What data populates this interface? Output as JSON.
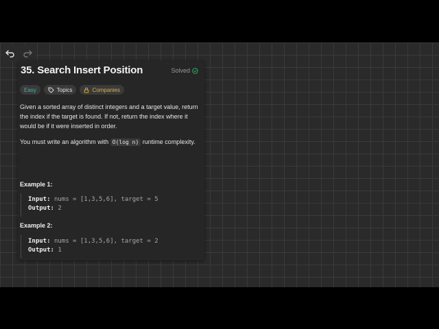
{
  "problem": {
    "title": "35. Search Insert Position",
    "status": "Solved",
    "tags": {
      "difficulty": "Easy",
      "topics": "Topics",
      "companies": "Companies"
    },
    "description": "Given a sorted array of distinct integers and a target value, return the index if the target is found. If not, return the index where it would be if it were inserted in order.",
    "constraint_prefix": "You must write an algorithm with",
    "constraint_code": "O(log n)",
    "constraint_suffix": "runtime complexity."
  },
  "examples": [
    {
      "heading": "Example 1:",
      "input_label": "Input:",
      "input_value": "nums = [1,3,5,6], target = 5",
      "output_label": "Output:",
      "output_value": "2"
    },
    {
      "heading": "Example 2:",
      "input_label": "Input:",
      "input_value": "nums = [1,3,5,6], target = 2",
      "output_label": "Output:",
      "output_value": "1"
    }
  ],
  "toolbar": {
    "undo_icon": "undo-icon",
    "redo_icon": "redo-icon"
  },
  "colors": {
    "easy": "#3fb3a9",
    "companies": "#e0b044",
    "solved_check": "#2cbb5d"
  }
}
